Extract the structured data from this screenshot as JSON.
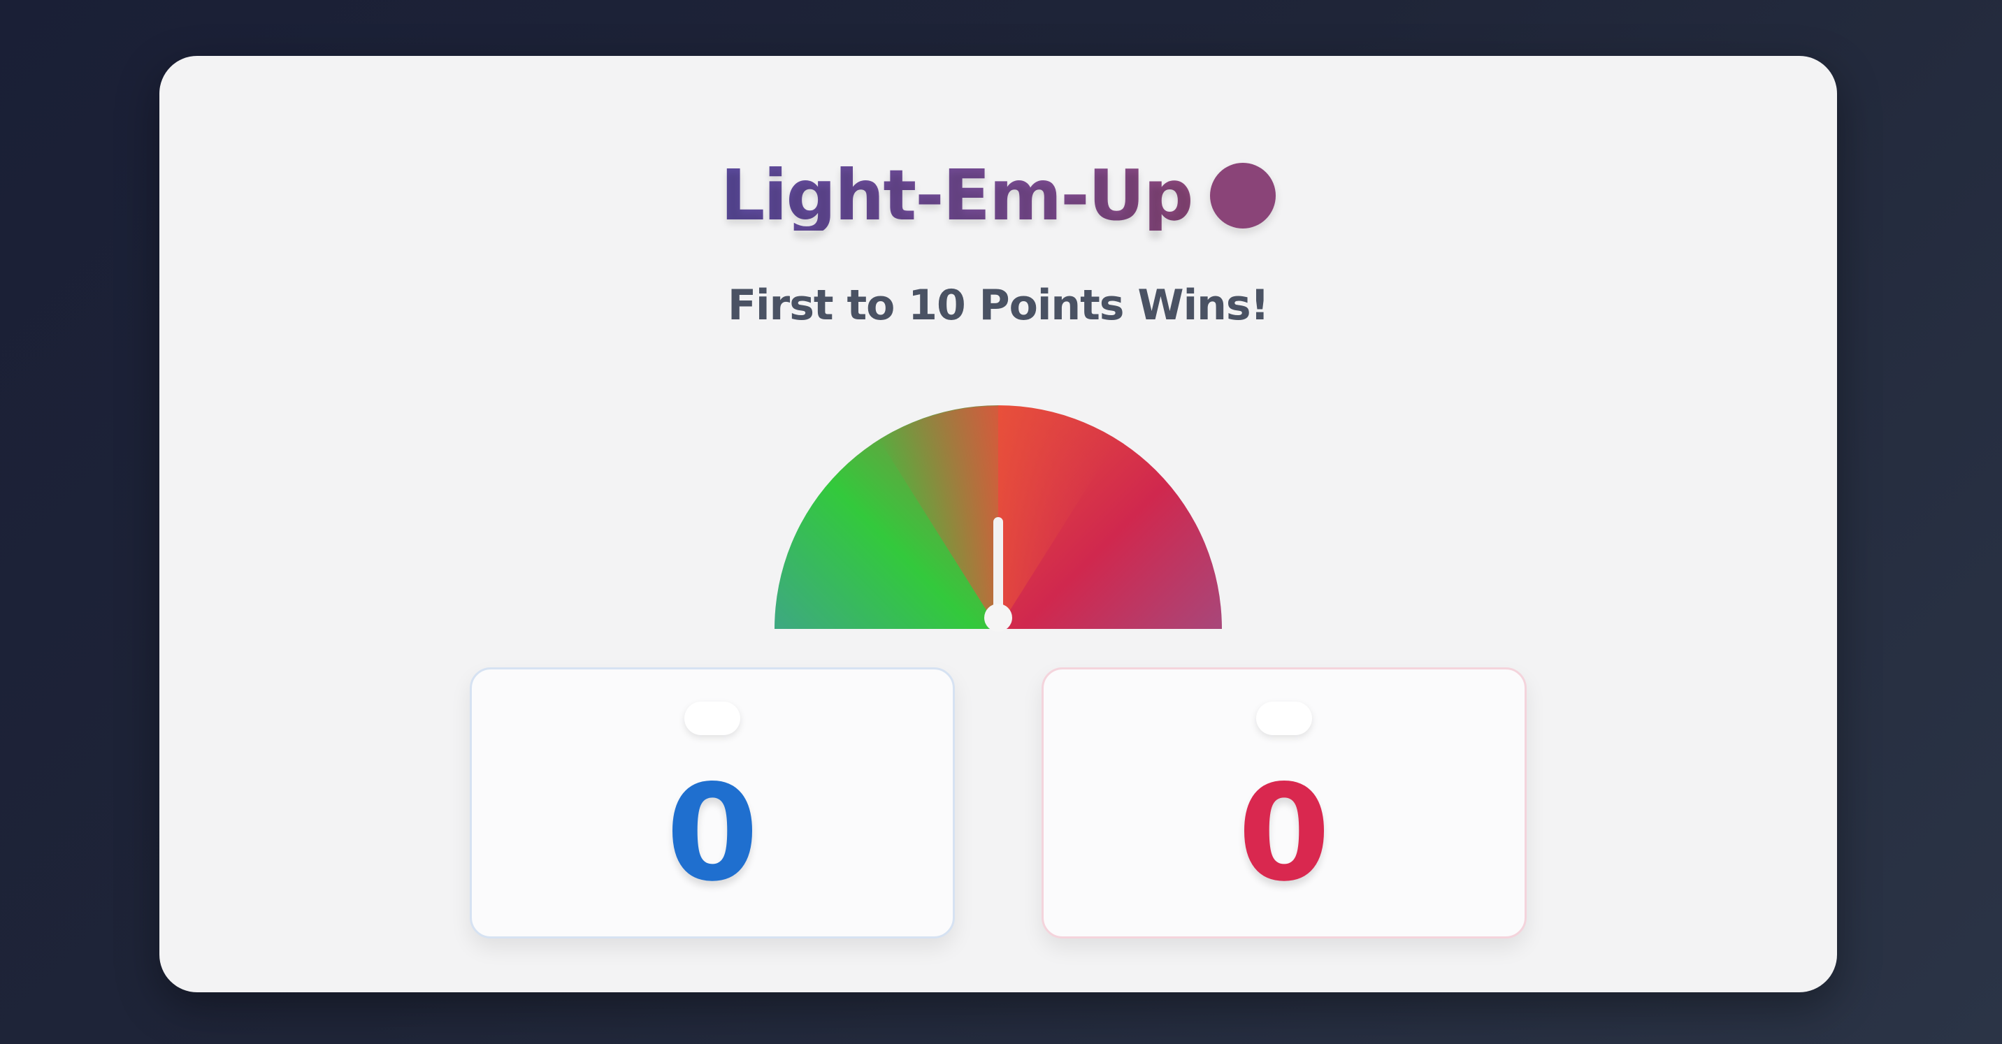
{
  "header": {
    "title": "Light-Em-Up",
    "title_dot_color": "#8a4478"
  },
  "subtitle": "First to 10 Points Wins!",
  "gauge": {
    "needle_position": 0.5,
    "colors": {
      "left": "#3ea882",
      "left_mid": "#33c93c",
      "center": "#e8503a",
      "right_mid": "#d0284e",
      "right": "#a8477a"
    }
  },
  "players": [
    {
      "score": "0",
      "color": "#1f6fcf",
      "border_color": "#d6e2f2"
    },
    {
      "score": "0",
      "color": "#d9284f",
      "border_color": "#f4d4dc"
    }
  ]
}
